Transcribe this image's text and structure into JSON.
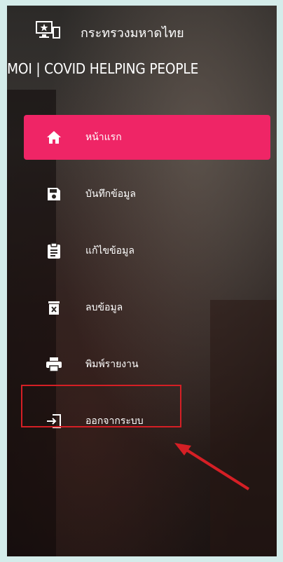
{
  "header": {
    "title": "กระทรวงมหาดไทย",
    "subtitle": "MOI | COVID HELPING PEOPLE",
    "icon": "monitor-star-icon"
  },
  "menu": {
    "items": [
      {
        "label": "หน้าแรก",
        "icon": "home-icon",
        "active": true
      },
      {
        "label": "บันทึกข้อมูล",
        "icon": "save-icon",
        "active": false
      },
      {
        "label": "แก้ไขข้อมูล",
        "icon": "clipboard-icon",
        "active": false
      },
      {
        "label": "ลบข้อมูล",
        "icon": "delete-icon",
        "active": false
      },
      {
        "label": "พิมพ์รายงาน",
        "icon": "print-icon",
        "active": false
      },
      {
        "label": "ออกจากระบบ",
        "icon": "logout-icon",
        "active": false
      }
    ]
  },
  "colors": {
    "active": "#ef2566",
    "annotation": "#d51f25",
    "page_background": "#d4ecea"
  }
}
